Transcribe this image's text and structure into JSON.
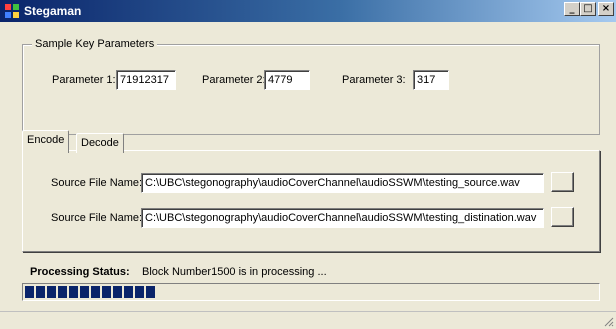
{
  "window": {
    "title": "Stegaman",
    "icon": "app-icon",
    "controls": {
      "minimize": "_",
      "maximize": "□",
      "close": "×"
    }
  },
  "parameters": {
    "group_label": "Sample Key Parameters",
    "param1": {
      "label": "Parameter 1:",
      "value": "71912317"
    },
    "param2": {
      "label": "Parameter 2:",
      "value": "4779"
    },
    "param3": {
      "label": "Parameter 3:",
      "value": "317"
    }
  },
  "tabs": [
    {
      "label": "Encode",
      "active": true
    },
    {
      "label": "Decode",
      "active": false
    }
  ],
  "encode": {
    "source": {
      "label": "Source File Name:",
      "value": "C:\\UBC\\stegonography\\audioCoverChannel\\audioSSWM\\testing_source.wav"
    },
    "destination": {
      "label": "Source File Name:",
      "value": "C:\\UBC\\stegonography\\audioCoverChannel\\audioSSWM\\testing_distination.wav"
    }
  },
  "status": {
    "label": "Processing Status:",
    "text": "Block Number1500 is in processing ...",
    "progress_fraction": 0.24
  },
  "colors": {
    "titlebar_start": "#0a246a",
    "titlebar_end": "#a6caf0",
    "progress_fill": "#0a246a",
    "window_bg": "#ece9d8"
  }
}
